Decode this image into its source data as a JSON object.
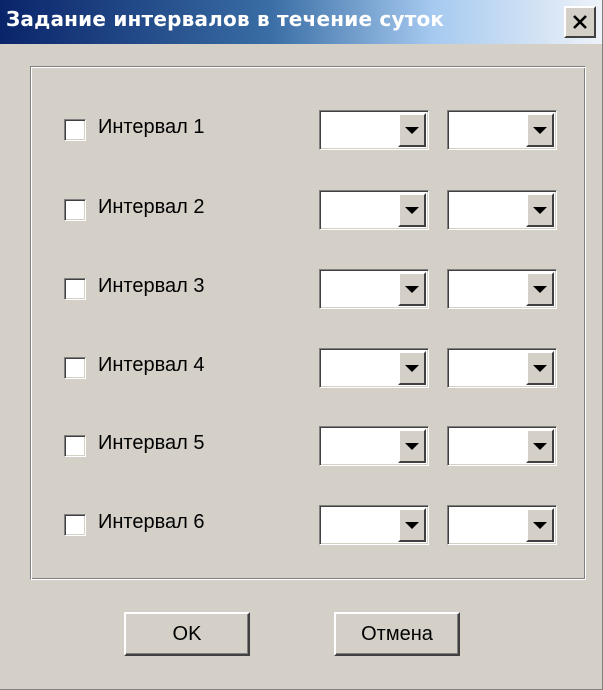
{
  "window": {
    "title": "Задание интервалов в течение суток",
    "close_icon": "close-icon"
  },
  "intervals": [
    {
      "label": "Интервал 1",
      "checked": false,
      "start_value": "",
      "end_value": ""
    },
    {
      "label": "Интервал 2",
      "checked": false,
      "start_value": "",
      "end_value": ""
    },
    {
      "label": "Интервал 3",
      "checked": false,
      "start_value": "",
      "end_value": ""
    },
    {
      "label": "Интервал 4",
      "checked": false,
      "start_value": "",
      "end_value": ""
    },
    {
      "label": "Интервал 5",
      "checked": false,
      "start_value": "",
      "end_value": ""
    },
    {
      "label": "Интервал 6",
      "checked": false,
      "start_value": "",
      "end_value": ""
    }
  ],
  "buttons": {
    "ok_label": "OK",
    "cancel_label": "Отмена"
  },
  "colors": {
    "title_bar_start": "#0a246a",
    "title_bar_end": "#eef2f8",
    "face": "#d4d0c8"
  }
}
